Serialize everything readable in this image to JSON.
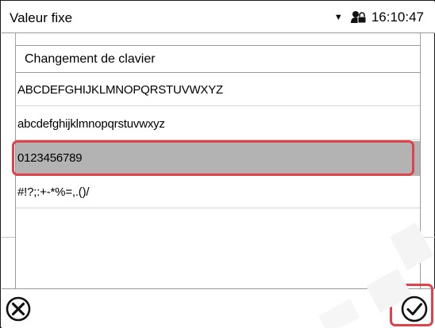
{
  "statusbar": {
    "title": "Valeur fixe",
    "dropdown_icon": "triangle-down-icon",
    "lock_icon": "user-lock-icon",
    "time": "16:10:47"
  },
  "panel": {
    "title": "Changement de clavier",
    "options": [
      {
        "label": "ABCDEFGHIJKLMNOPQRSTUVWXYZ",
        "selected": false
      },
      {
        "label": "abcdefghijklmnopqrstuvwxyz",
        "selected": false
      },
      {
        "label": "0123456789",
        "selected": true
      },
      {
        "label": "#!?;:+-*%=,.()/",
        "selected": false
      }
    ]
  },
  "footer": {
    "cancel_icon": "circle-x-icon",
    "confirm_icon": "circle-check-icon"
  },
  "colors": {
    "highlight": "#e0424a",
    "selected_row": "#b3b3b3",
    "border": "#9a9a9a"
  }
}
